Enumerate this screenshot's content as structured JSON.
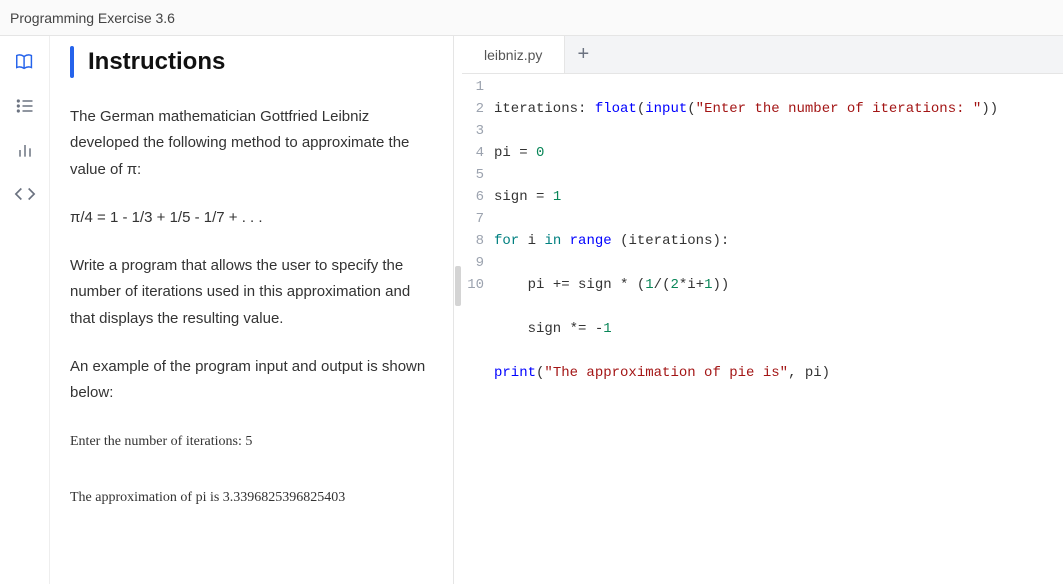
{
  "header": {
    "title": "Programming Exercise 3.6"
  },
  "rail": {
    "items": [
      {
        "name": "book-icon"
      },
      {
        "name": "list-icon"
      },
      {
        "name": "chart-icon"
      },
      {
        "name": "code-icon"
      }
    ]
  },
  "instructions": {
    "title": "Instructions",
    "p1": "The German mathematician Gottfried Leibniz developed the following method to approximate the value of π:",
    "p2": "π/4 = 1 - 1/3 + 1/5 - 1/7 + . . .",
    "p3": "Write a program that allows the user to specify the number of iterations used in this approximation and that displays the resulting value.",
    "p4": "An example of the program input and output is shown below:",
    "example_line1": "Enter the number of iterations: 5",
    "example_line2": "The approximation of pi is 3.3396825396825403"
  },
  "editor": {
    "filename": "leibniz.py",
    "add_label": "+",
    "lines": {
      "l1_a": "iterations: ",
      "l1_fn": "float",
      "l1_b": "(",
      "l1_fn2": "input",
      "l1_c": "(",
      "l1_str": "\"Enter the number of iterations: \"",
      "l1_d": "))",
      "l2_a": "pi ",
      "l2_op": "=",
      "l2_b": " ",
      "l2_num": "0",
      "l3_a": "sign ",
      "l3_op": "=",
      "l3_b": " ",
      "l3_num": "1",
      "l4_kw1": "for",
      "l4_a": " i ",
      "l4_kw2": "in",
      "l4_b": " ",
      "l4_fn": "range",
      "l4_c": " (iterations):",
      "l5_a": "    pi ",
      "l5_op": "+=",
      "l5_b": " sign ",
      "l5_op2": "*",
      "l5_c": " (",
      "l5_num1": "1",
      "l5_d": "/(",
      "l5_num2": "2",
      "l5_op3": "*",
      "l5_e": "i",
      "l5_op4": "+",
      "l5_num3": "1",
      "l5_f": "))",
      "l6_a": "    sign ",
      "l6_op": "*=",
      "l6_b": " ",
      "l6_op2": "-",
      "l6_num": "1",
      "l7_fn": "print",
      "l7_a": "(",
      "l7_str": "\"The approximation of pie is\"",
      "l7_b": ", pi)",
      "gutter": [
        "1",
        "2",
        "3",
        "4",
        "5",
        "6",
        "7",
        "8",
        "9",
        "10"
      ]
    }
  }
}
